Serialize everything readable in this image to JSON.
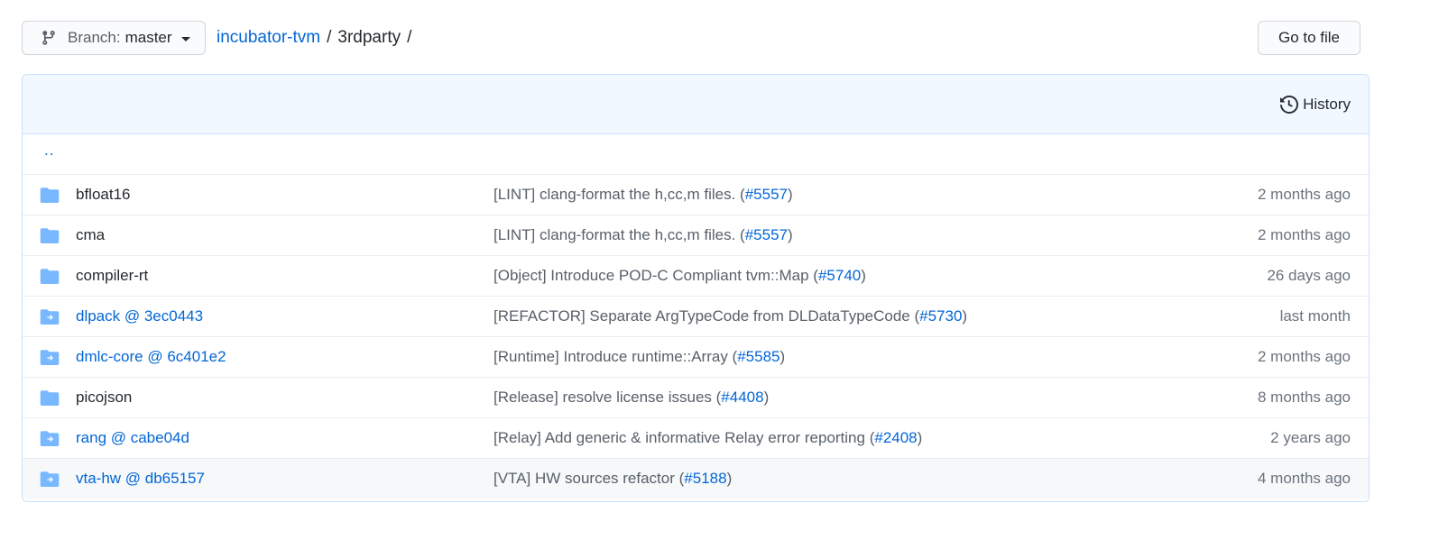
{
  "branch": {
    "label": "Branch:",
    "value": "master"
  },
  "breadcrumb": {
    "repo": "incubator-tvm",
    "separator": "/",
    "current": "3rdparty",
    "trailing": "/"
  },
  "go_to_file": "Go to file",
  "history": "History",
  "up_dir": "..",
  "files": [
    {
      "name": "bfloat16",
      "type": "folder",
      "message": "[LINT] clang-format the h,cc,m files. (",
      "pr": "#5557",
      "close": ")",
      "age": "2 months ago"
    },
    {
      "name": "cma",
      "type": "folder",
      "message": "[LINT] clang-format the h,cc,m files. (",
      "pr": "#5557",
      "close": ")",
      "age": "2 months ago"
    },
    {
      "name": "compiler-rt",
      "type": "folder",
      "message": "[Object] Introduce POD-C Compliant tvm::Map (",
      "pr": "#5740",
      "close": ")",
      "age": "26 days ago"
    },
    {
      "name": "dlpack @ 3ec0443",
      "type": "submodule",
      "message": "[REFACTOR] Separate ArgTypeCode from DLDataTypeCode (",
      "pr": "#5730",
      "close": ")",
      "age": "last month"
    },
    {
      "name": "dmlc-core @ 6c401e2",
      "type": "submodule",
      "message": "[Runtime] Introduce runtime::Array (",
      "pr": "#5585",
      "close": ")",
      "age": "2 months ago"
    },
    {
      "name": "picojson",
      "type": "folder",
      "message": "[Release] resolve license issues (",
      "pr": "#4408",
      "close": ")",
      "age": "8 months ago"
    },
    {
      "name": "rang @ cabe04d",
      "type": "submodule",
      "message": "[Relay] Add generic & informative Relay error reporting (",
      "pr": "#2408",
      "close": ")",
      "age": "2 years ago"
    },
    {
      "name": "vta-hw @ db65157",
      "type": "submodule",
      "message": "[VTA] HW sources refactor (",
      "pr": "#5188",
      "close": ")",
      "age": "4 months ago"
    }
  ],
  "colors": {
    "link": "#0366d6",
    "folder": "#79b8ff",
    "header_bg": "#f1f8ff",
    "border": "#c8e1ff"
  },
  "icons": {
    "branch": "git-branch-icon",
    "history": "history-icon",
    "folder": "folder-icon",
    "submodule": "submodule-folder-icon",
    "caret": "chevron-down-icon"
  }
}
